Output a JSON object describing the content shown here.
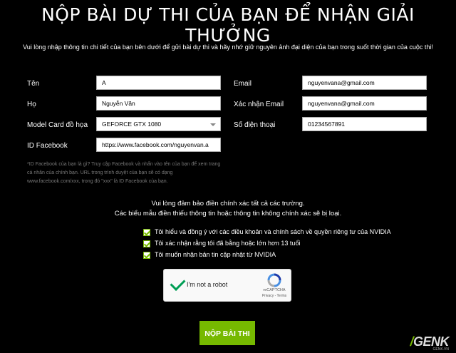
{
  "title": "NỘP BÀI DỰ THI CỦA BẠN ĐỂ NHẬN GIẢI THƯỞNG",
  "subtitle": "Vui lòng nhập thông tin chi tiết của bạn bên dưới để gửi bài dự thi và hãy nhớ giữ nguyên ảnh đại diện của bạn trong suốt thời gian của cuộc thi!",
  "form": {
    "ten": {
      "label": "Tên",
      "value": "A"
    },
    "ho": {
      "label": "Họ",
      "value": "Nguyễn Văn"
    },
    "model": {
      "label": "Model Card đồ họa",
      "value": "GEFORCE GTX 1080"
    },
    "facebook": {
      "label": "ID Facebook",
      "value": "https://www.facebook.com/nguyenvan.a"
    },
    "email": {
      "label": "Email",
      "value": "nguyenvana@gmail.com"
    },
    "email_confirm": {
      "label": "Xác nhận Email",
      "value": "nguyenvana@gmail.com"
    },
    "phone": {
      "label": "Số điện thoại",
      "value": "01234567891"
    }
  },
  "help_text": "*ID Facebook của bạn là gì? Truy cập Facebook và nhấn vào tên của bạn để xem trang cá nhân của chính bạn. URL trong trình duyệt của bạn sẽ có dạng www.facebook.com/xxx, trong đó \"xxx\" là ID Facebook của bạn.",
  "notice_line1": "Vui lòng đảm bảo điền chính xác tất cả các trường.",
  "notice_line2": "Các biểu mẫu điền thiếu thông tin hoặc thông tin không chính xác sẽ bị loại.",
  "checkboxes": [
    {
      "label": "Tôi hiểu và đồng ý với các điều khoản và chính sách về quyền riêng tư của NVIDIA",
      "checked": true
    },
    {
      "label": "Tôi xác nhận rằng tôi đã bằng hoặc lớn hơn 13 tuổi",
      "checked": true
    },
    {
      "label": "Tôi muốn nhận bản tin cập nhật từ NVIDIA",
      "checked": true
    }
  ],
  "captcha": {
    "text": "I'm not a robot",
    "brand": "reCAPTCHA",
    "links": "Privacy - Terms"
  },
  "submit_label": "NỘP BÀI THI",
  "watermark": {
    "logo_slash": "/",
    "logo": "GENK",
    "sub": "GENK.VN"
  },
  "colors": {
    "accent": "#76b900",
    "background": "#000000"
  }
}
